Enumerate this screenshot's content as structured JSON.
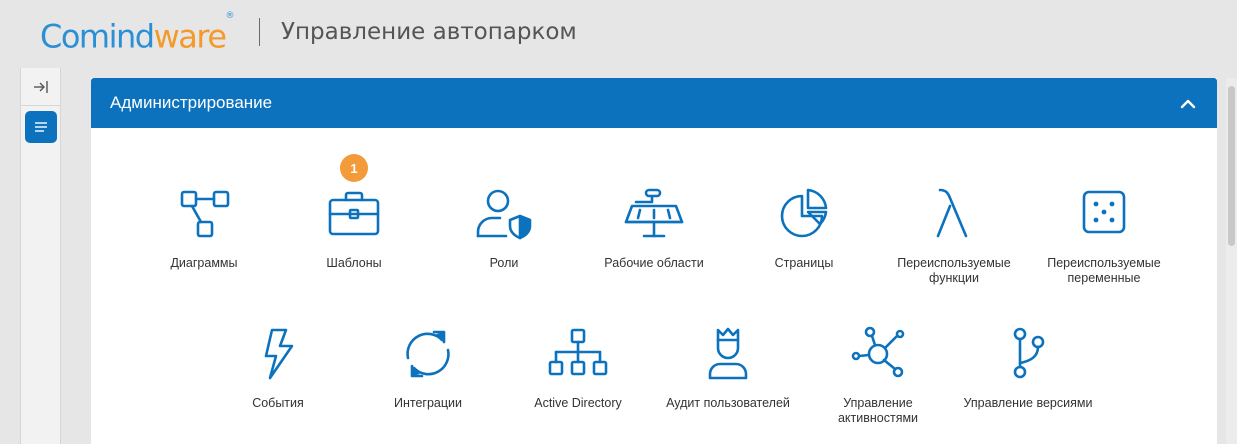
{
  "brand": {
    "logo_main": "Comind",
    "logo_accent": "ware",
    "logo_mark": "®",
    "app_title": "Управление автопарком"
  },
  "colors": {
    "primary": "#0c72be",
    "accent": "#f39a2a",
    "badge": "#f39a3b"
  },
  "sidebar": {
    "collapse_icon": "collapse-to-right-icon",
    "menu_icon": "menu-list-icon"
  },
  "panel": {
    "title": "Администрирование",
    "toggle_icon": "chevron-up-icon"
  },
  "tiles_row1": [
    {
      "label": "Диаграммы",
      "icon": "diagram-icon"
    },
    {
      "label": "Шаблоны",
      "icon": "toolbox-icon",
      "badge": "1"
    },
    {
      "label": "Роли",
      "icon": "user-shield-icon"
    },
    {
      "label": "Рабочие области",
      "icon": "workspace-icon"
    },
    {
      "label": "Страницы",
      "icon": "pie-page-icon"
    },
    {
      "label": "Переиспользуемые функции",
      "icon": "lambda-icon"
    },
    {
      "label": "Переиспользуемые переменные",
      "icon": "dice-icon"
    }
  ],
  "tiles_row2": [
    {
      "label": "События",
      "icon": "lightning-icon"
    },
    {
      "label": "Интеграции",
      "icon": "sync-icon"
    },
    {
      "label": "Active Directory",
      "icon": "hierarchy-icon"
    },
    {
      "label": "Аудит пользователей",
      "icon": "crowned-user-icon"
    },
    {
      "label": "Управление активностями",
      "icon": "activity-network-icon"
    },
    {
      "label": "Управление версиями",
      "icon": "branch-icon"
    }
  ]
}
